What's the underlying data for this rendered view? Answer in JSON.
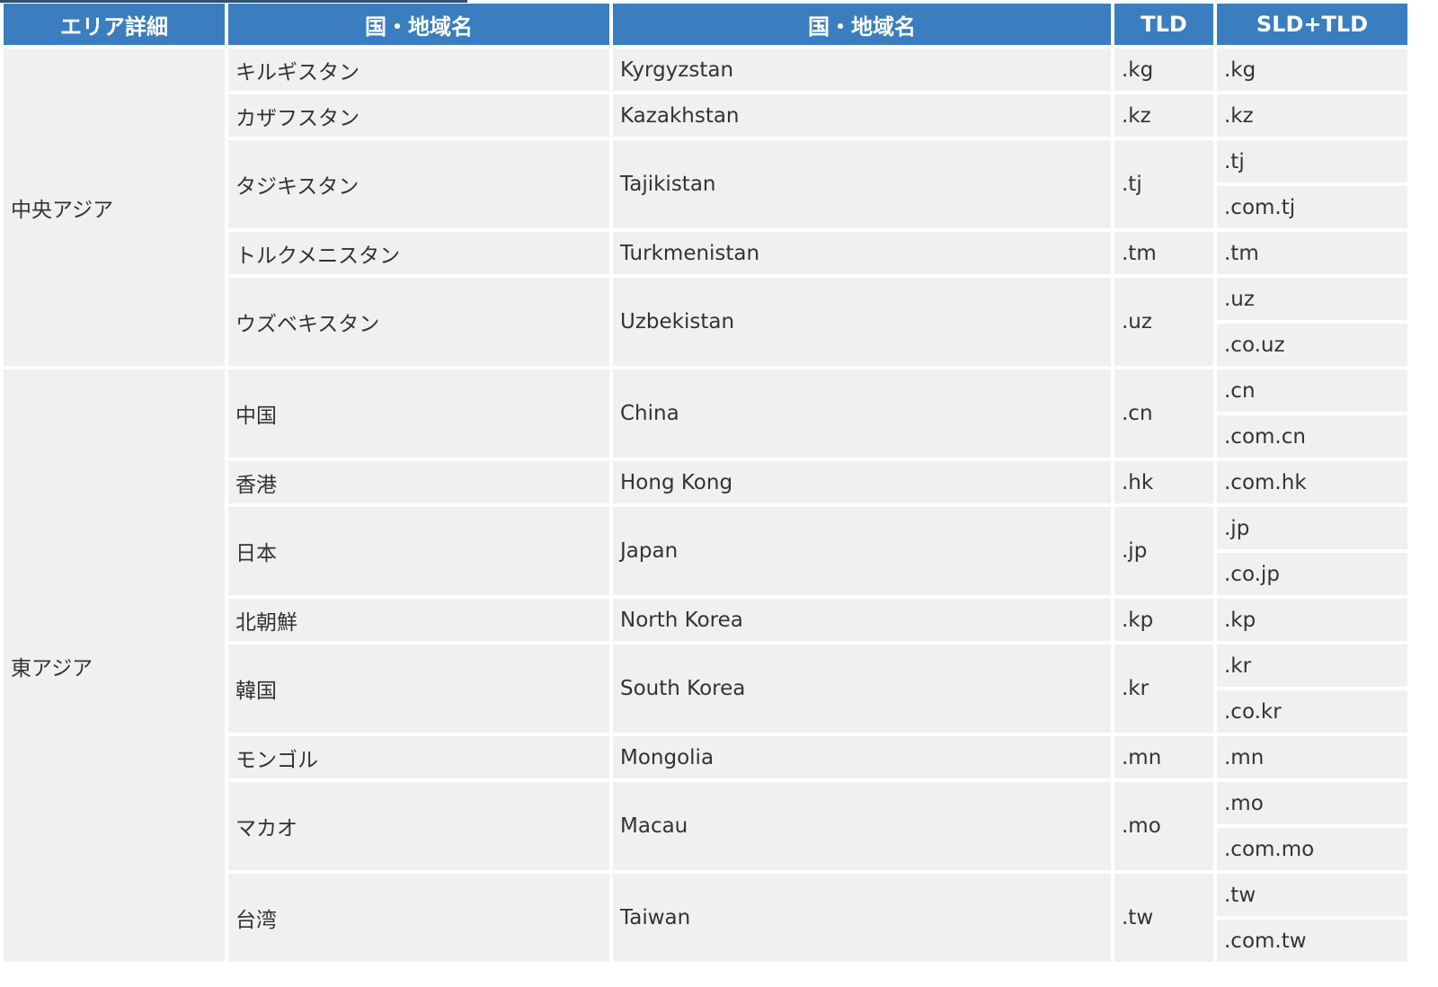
{
  "headers": {
    "area": "エリア詳細",
    "country_ja": "国・地域名",
    "country_en": "国・地域名",
    "tld": "TLD",
    "sld_tld": "SLD+TLD"
  },
  "groups": [
    {
      "area": "中央アジア",
      "countries": [
        {
          "ja": "キルギスタン",
          "en": "Kyrgyzstan",
          "tld": ".kg",
          "sld": [
            ".kg"
          ]
        },
        {
          "ja": "カザフスタン",
          "en": "Kazakhstan",
          "tld": ".kz",
          "sld": [
            ".kz"
          ]
        },
        {
          "ja": "タジキスタン",
          "en": "Tajikistan",
          "tld": ".tj",
          "sld": [
            ".tj",
            ".com.tj"
          ]
        },
        {
          "ja": "トルクメニスタン",
          "en": "Turkmenistan",
          "tld": ".tm",
          "sld": [
            ".tm"
          ]
        },
        {
          "ja": "ウズベキスタン",
          "en": "Uzbekistan",
          "tld": ".uz",
          "sld": [
            ".uz",
            ".co.uz"
          ]
        }
      ]
    },
    {
      "area": "東アジア",
      "countries": [
        {
          "ja": "中国",
          "en": "China",
          "tld": ".cn",
          "sld": [
            ".cn",
            ".com.cn"
          ]
        },
        {
          "ja": "香港",
          "en": "Hong Kong",
          "tld": ".hk",
          "sld": [
            ".com.hk"
          ]
        },
        {
          "ja": "日本",
          "en": "Japan",
          "tld": ".jp",
          "sld": [
            ".jp",
            ".co.jp"
          ]
        },
        {
          "ja": "北朝鮮",
          "en": "North Korea",
          "tld": ".kp",
          "sld": [
            ".kp"
          ]
        },
        {
          "ja": "韓国",
          "en": "South Korea",
          "tld": ".kr",
          "sld": [
            ".kr",
            ".co.kr"
          ]
        },
        {
          "ja": "モンゴル",
          "en": "Mongolia",
          "tld": ".mn",
          "sld": [
            ".mn"
          ]
        },
        {
          "ja": "マカオ",
          "en": "Macau",
          "tld": ".mo",
          "sld": [
            ".mo",
            ".com.mo"
          ]
        },
        {
          "ja": "台湾",
          "en": "Taiwan",
          "tld": ".tw",
          "sld": [
            ".tw",
            ".com.tw"
          ]
        }
      ]
    }
  ]
}
